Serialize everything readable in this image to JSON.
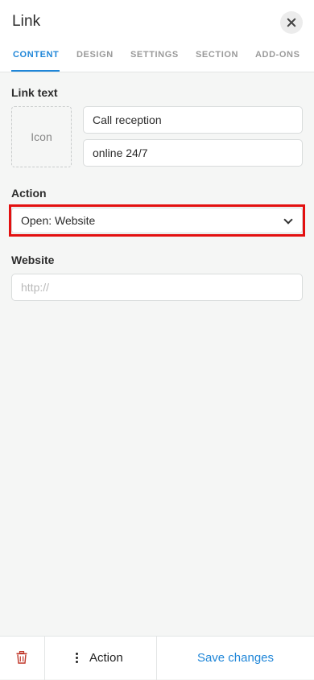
{
  "header": {
    "title": "Link",
    "close_icon": "close-icon"
  },
  "tabs": [
    {
      "label": "CONTENT",
      "active": true
    },
    {
      "label": "DESIGN",
      "active": false
    },
    {
      "label": "SETTINGS",
      "active": false
    },
    {
      "label": "SECTION",
      "active": false
    },
    {
      "label": "ADD-ONS",
      "active": false
    }
  ],
  "link_text": {
    "label": "Link text",
    "icon_placeholder": "Icon",
    "primary_value": "Call reception",
    "secondary_value": "online 24/7"
  },
  "action": {
    "label": "Action",
    "selected": "Open: Website",
    "chevron_icon": "chevron-down-icon"
  },
  "website": {
    "label": "Website",
    "value": "",
    "placeholder": "http://"
  },
  "footer": {
    "delete_icon": "trash-icon",
    "action_icon": "more-vertical-icon",
    "action_label": "Action",
    "save_label": "Save changes"
  },
  "colors": {
    "accent": "#1f86d8",
    "highlight": "#e31010",
    "delete": "#c0392b",
    "background": "#f5f6f5"
  }
}
